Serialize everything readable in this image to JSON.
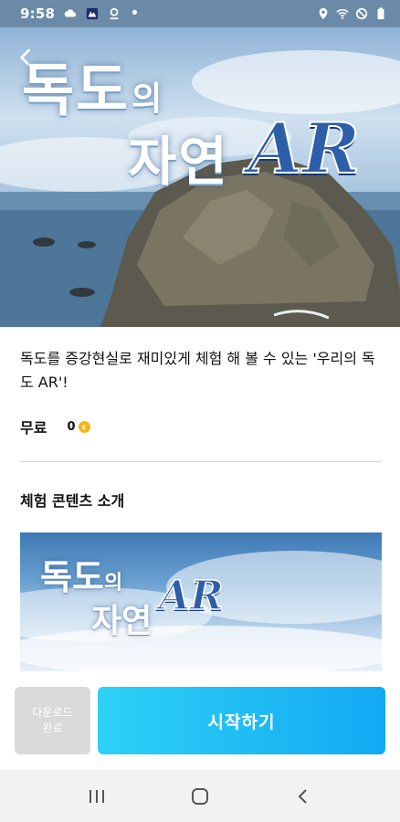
{
  "status_bar": {
    "time": "9:58",
    "left_icons": [
      "cloud-icon",
      "app-notification-icon",
      "location-pin-icon",
      "dot-icon"
    ],
    "right_icons": [
      "location-icon",
      "wifi-icon",
      "do-not-disturb-icon",
      "battery-icon"
    ]
  },
  "hero": {
    "title_line1": "독도",
    "title_line1_small": "의",
    "title_line2": "자연",
    "title_ar": "AR"
  },
  "description": "독도를 증강현실로 재미있게 체험 해 볼 수 있는 '우리의 독도 AR'!",
  "price": {
    "label": "무료",
    "amount": "0"
  },
  "section": {
    "title": "체험 콘텐츠 소개"
  },
  "preview": {
    "title_line1": "독도",
    "title_line1_small": "의",
    "title_line2": "자연",
    "title_ar": "AR"
  },
  "actions": {
    "download_label_line1": "다운로드",
    "download_label_line2": "완료",
    "start_label": "시작하기"
  },
  "nav": {
    "items": [
      "recent-apps-icon",
      "home-icon",
      "back-icon"
    ]
  },
  "colors": {
    "accent_start": "#2ed1f5",
    "accent_end": "#12a9f4",
    "disabled": "#d9d9d9"
  }
}
